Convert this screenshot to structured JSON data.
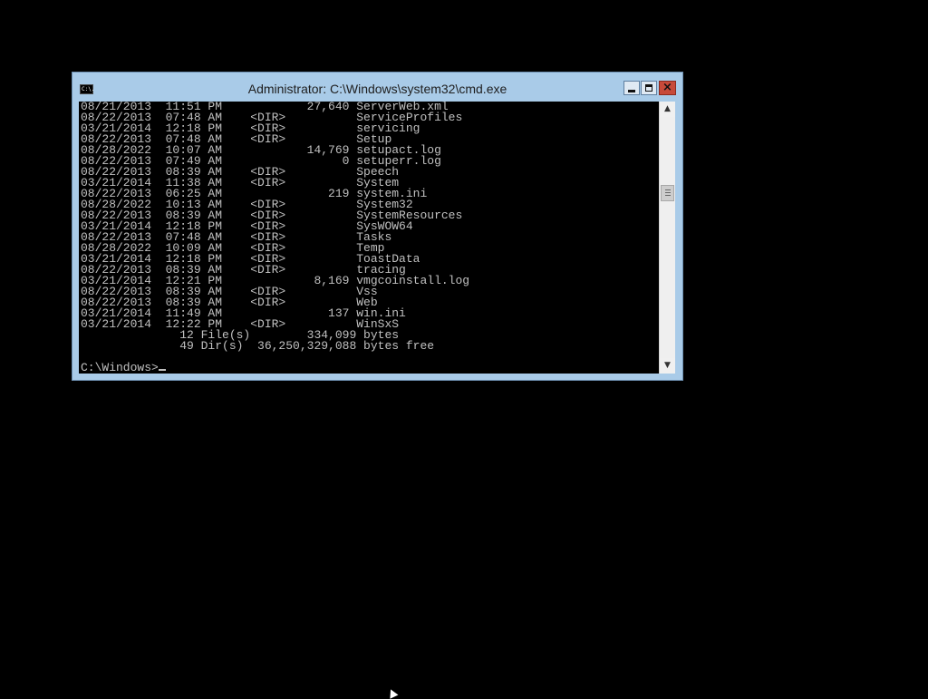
{
  "window": {
    "title": "Administrator: C:\\Windows\\system32\\cmd.exe",
    "icon_text": "C:\\.",
    "controls": {
      "minimize": "minimize",
      "maximize": "maximize",
      "close": "×"
    }
  },
  "console": {
    "lines": [
      "08/21/2013  11:51 PM            27,640 ServerWeb.xml",
      "08/22/2013  07:48 AM    <DIR>          ServiceProfiles",
      "03/21/2014  12:18 PM    <DIR>          servicing",
      "08/22/2013  07:48 AM    <DIR>          Setup",
      "08/28/2022  10:07 AM            14,769 setupact.log",
      "08/22/2013  07:49 AM                 0 setuperr.log",
      "08/22/2013  08:39 AM    <DIR>          Speech",
      "03/21/2014  11:38 AM    <DIR>          System",
      "08/22/2013  06:25 AM               219 system.ini",
      "08/28/2022  10:13 AM    <DIR>          System32",
      "08/22/2013  08:39 AM    <DIR>          SystemResources",
      "03/21/2014  12:18 PM    <DIR>          SysWOW64",
      "08/22/2013  07:48 AM    <DIR>          Tasks",
      "08/28/2022  10:09 AM    <DIR>          Temp",
      "03/21/2014  12:18 PM    <DIR>          ToastData",
      "08/22/2013  08:39 AM    <DIR>          tracing",
      "03/21/2014  12:21 PM             8,169 vmgcoinstall.log",
      "08/22/2013  08:39 AM    <DIR>          Vss",
      "08/22/2013  08:39 AM    <DIR>          Web",
      "03/21/2014  11:49 AM               137 win.ini",
      "03/21/2014  12:22 PM    <DIR>          WinSxS",
      "              12 File(s)        334,099 bytes",
      "              49 Dir(s)  36,250,329,088 bytes free",
      ""
    ],
    "prompt": "C:\\Windows>"
  },
  "scrollbar": {
    "up_glyph": "▲",
    "down_glyph": "▼"
  }
}
